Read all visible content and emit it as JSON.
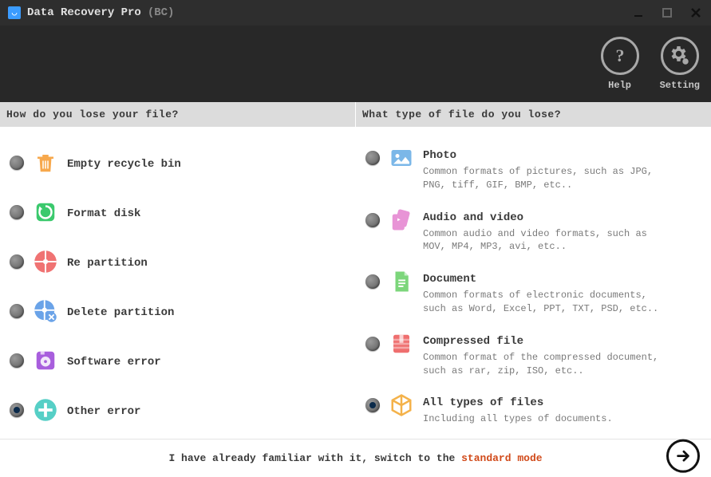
{
  "title": {
    "app_name": "Data Recovery Pro",
    "suffix": "(BC)"
  },
  "toolbar": {
    "help_label": "Help",
    "setting_label": "Setting"
  },
  "left": {
    "header": "How do you lose your file?",
    "options": [
      {
        "title": "Empty recycle bin",
        "icon": "trash",
        "color": "#f7a84c",
        "selected": false
      },
      {
        "title": "Format disk",
        "icon": "format",
        "color": "#3bc96d",
        "selected": false
      },
      {
        "title": "Re partition",
        "icon": "partition",
        "color": "#f07373",
        "selected": false
      },
      {
        "title": "Delete partition",
        "icon": "del-partition",
        "color": "#6aa3e8",
        "selected": false
      },
      {
        "title": "Software error",
        "icon": "software",
        "color": "#a85edd",
        "selected": false
      },
      {
        "title": "Other error",
        "icon": "other",
        "color": "#56cfc6",
        "selected": true
      }
    ]
  },
  "right": {
    "header": "What type of file do you lose?",
    "options": [
      {
        "title": "Photo",
        "desc": "Common formats of pictures, such as JPG, PNG, tiff, GIF, BMP, etc..",
        "icon": "photo",
        "color": "#7bb7e8",
        "selected": false
      },
      {
        "title": "Audio and video",
        "desc": "Common audio and video formats, such as MOV, MP4, MP3, avi, etc..",
        "icon": "media",
        "color": "#e894d6",
        "selected": false
      },
      {
        "title": "Document",
        "desc": "Common formats of electronic documents, such as Word, Excel, PPT, TXT, PSD, etc..",
        "icon": "document",
        "color": "#7cd67b",
        "selected": false
      },
      {
        "title": "Compressed file",
        "desc": "Common format of the compressed document, such as rar, zip, ISO, etc..",
        "icon": "zip",
        "color": "#ef6f6f",
        "selected": false
      },
      {
        "title": "All types of files",
        "desc": "Including all types of documents.",
        "icon": "all",
        "color": "#f4b24a",
        "selected": true
      }
    ]
  },
  "footer": {
    "text_before": "I have already familiar with it, switch to the ",
    "link": "standard mode"
  }
}
